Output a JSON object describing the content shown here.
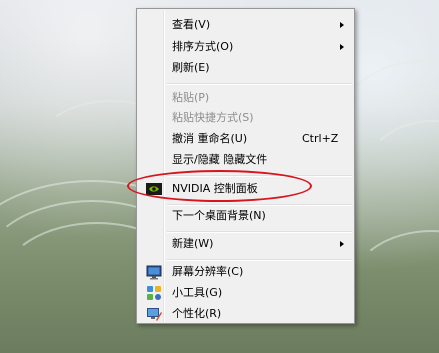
{
  "context_menu": {
    "view": "查看(V)",
    "sort_by": "排序方式(O)",
    "refresh": "刷新(E)",
    "paste": "粘贴(P)",
    "paste_shortcut": "粘贴快捷方式(S)",
    "undo_rename": "撤消 重命名(U)",
    "undo_shortcut": "Ctrl+Z",
    "show_hide_hidden": "显示/隐藏 隐藏文件",
    "nvidia_control_panel": "NVIDIA 控制面板",
    "next_background": "下一个桌面背景(N)",
    "new": "新建(W)",
    "screen_resolution": "屏幕分辨率(C)",
    "gadgets": "小工具(G)",
    "personalize": "个性化(R)"
  },
  "disabled_items": [
    "paste",
    "paste_shortcut"
  ],
  "colors": {
    "menu_background": "#f0f0f0",
    "annotation_ellipse": "#d5161e",
    "nvidia_green": "#76b900"
  },
  "icons": {
    "nvidia_control_panel": "nvidia-icon",
    "screen_resolution": "monitor-icon",
    "gadgets": "gadgets-icon",
    "personalize": "personalize-icon"
  }
}
